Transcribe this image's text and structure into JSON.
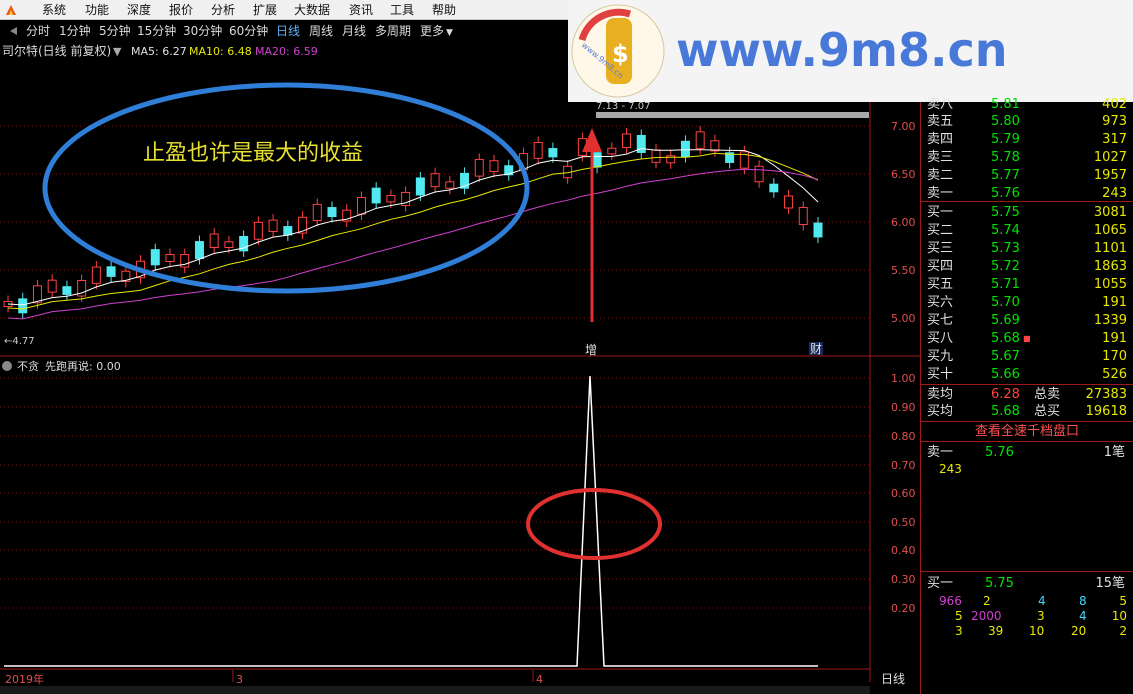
{
  "menu": {
    "items": [
      "系统",
      "功能",
      "深度",
      "报价",
      "分析",
      "扩展",
      "大数据",
      "资讯",
      "工具",
      "帮助"
    ]
  },
  "periods": {
    "items": [
      "分时",
      "1分钟",
      "5分钟",
      "15分钟",
      "30分钟",
      "60分钟",
      "日线",
      "周线",
      "月线",
      "多周期",
      "更多"
    ],
    "active": "日线"
  },
  "chart_header": {
    "stock": "司尔特(日线 前复权)",
    "ma5": "MA5: 6.27",
    "ma10": "MA10: 6.48",
    "ma20": "MA20: 6.59"
  },
  "annotation": {
    "text": "止盈也许是最大的收益"
  },
  "watermark": {
    "text": "www.9m8.cn",
    "logo_text": "www.9m8.cn"
  },
  "price_axis": {
    "ticks": [
      "7.00",
      "6.50",
      "6.00",
      "5.50",
      "5.00"
    ]
  },
  "price_labels": {
    "low": "4.77",
    "high": "7.13 - 7.07"
  },
  "event_markers": {
    "zeng": "增",
    "cai": "财"
  },
  "indicator": {
    "name": "不贪",
    "label": "先跑再说: 0.00",
    "ticks": [
      "1.00",
      "0.90",
      "0.80",
      "0.70",
      "0.60",
      "0.50",
      "0.40",
      "0.30",
      "0.20"
    ]
  },
  "time_axis": {
    "labels": [
      "2019年",
      "3",
      "4"
    ],
    "period": "日线"
  },
  "orderbook": {
    "sells": [
      {
        "label": "卖八",
        "price": "5.81",
        "vol": "402"
      },
      {
        "label": "卖五",
        "price": "5.80",
        "vol": "973"
      },
      {
        "label": "卖四",
        "price": "5.79",
        "vol": "317"
      },
      {
        "label": "卖三",
        "price": "5.78",
        "vol": "1027"
      },
      {
        "label": "卖二",
        "price": "5.77",
        "vol": "1957"
      },
      {
        "label": "卖一",
        "price": "5.76",
        "vol": "243"
      }
    ],
    "buys": [
      {
        "label": "买一",
        "price": "5.75",
        "vol": "3081"
      },
      {
        "label": "买二",
        "price": "5.74",
        "vol": "1065"
      },
      {
        "label": "买三",
        "price": "5.73",
        "vol": "1101"
      },
      {
        "label": "买四",
        "price": "5.72",
        "vol": "1863"
      },
      {
        "label": "买五",
        "price": "5.71",
        "vol": "1055"
      },
      {
        "label": "买六",
        "price": "5.70",
        "vol": "191"
      },
      {
        "label": "买七",
        "price": "5.69",
        "vol": "1339"
      },
      {
        "label": "买八",
        "price": "5.68",
        "vol": "191"
      },
      {
        "label": "买九",
        "price": "5.67",
        "vol": "170"
      },
      {
        "label": "买十",
        "price": "5.66",
        "vol": "526"
      }
    ],
    "sell_avg_label": "卖均",
    "sell_avg": "6.28",
    "total_sell_label": "总卖",
    "total_sell": "27383",
    "buy_avg_label": "买均",
    "buy_avg": "5.68",
    "total_buy_label": "总买",
    "total_buy": "19618",
    "qianbang_link": "查看全速千档盘口"
  },
  "queue": {
    "sell1_label": "卖一",
    "sell1_price": "5.76",
    "sell1_count": "1笔",
    "sell1_vol": "243",
    "buy1_label": "买一",
    "buy1_price": "5.75",
    "buy1_count": "15笔",
    "rows": [
      [
        "966",
        "2",
        "4",
        "8",
        "5"
      ],
      [
        "5",
        "2000",
        "3",
        "4",
        "10"
      ],
      [
        "3",
        "39",
        "10",
        "20",
        "2"
      ]
    ]
  },
  "colors": {
    "up": "#ff4242",
    "down": "#52e8f0",
    "ma5": "#ffffff",
    "ma10": "#e8e800",
    "ma20": "#d040d0",
    "grid": "#7a1010",
    "ellipse_blue": "#2f7fd8",
    "ellipse_red": "#e03030",
    "arrow_red": "#e03030"
  }
}
